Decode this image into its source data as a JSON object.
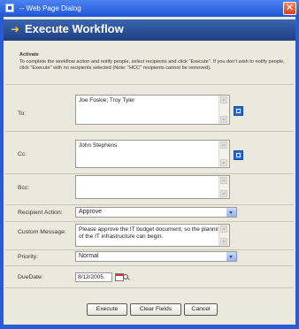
{
  "window": {
    "title": "-- Web Page Dialog"
  },
  "header": {
    "title": "Execute Workflow"
  },
  "notice": {
    "action": "Activate",
    "text": "To complete the workflow action and notify people, select recipients and click \"Execute\". If you don't wish to notify people, click \"Execute\" with no recipients selected (Note: \"HCC\" recipients cannot be removed)."
  },
  "form": {
    "to_label": "To:",
    "to_value": "Joe Foskie; Troy Tyler",
    "cc_label": "Cc:",
    "cc_value": "John Stephens",
    "bcc_label": "Bcc:",
    "bcc_value": "",
    "recipient_action_label": "Recipient Action:",
    "recipient_action_value": "Approve",
    "custom_message_label": "Custom Message:",
    "custom_message_value": "Please approve the IT budget document, so the planning of the IT infrastructure can begin.",
    "priority_label": "Priority:",
    "priority_value": "Normal",
    "duedate_label": "DueDate:",
    "duedate_value": "8/12/2005"
  },
  "buttons": {
    "execute": "Execute",
    "clear": "Clear Fields",
    "cancel": "Cancel"
  },
  "colors": {
    "titlebar": "#1f56d8",
    "header": "#1e3f80",
    "client_bg": "#ebe9dd",
    "close": "#d8401c"
  }
}
